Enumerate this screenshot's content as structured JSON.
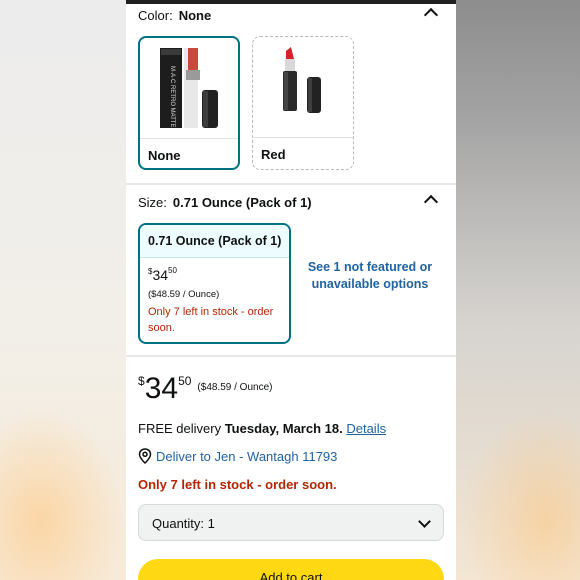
{
  "color_section": {
    "label": "Color:",
    "selected": "None",
    "options": [
      {
        "label": "None"
      },
      {
        "label": "Red"
      }
    ]
  },
  "size_section": {
    "label": "Size:",
    "selected": "0.71 Ounce (Pack of 1)",
    "card": {
      "title": "0.71 Ounce (Pack of 1)",
      "currency": "$",
      "price_whole": "34",
      "price_fraction": "50",
      "unit_price": "($48.59 / Ounce)",
      "stock": "Only 7 left in stock - order soon."
    },
    "see_more": "See 1 not featured or unavailable options"
  },
  "buybox": {
    "currency": "$",
    "price_whole": "34",
    "price_fraction": "50",
    "unit_price": "($48.59 / Ounce)",
    "delivery_prefix": "FREE delivery",
    "delivery_date": "Tuesday, March 18.",
    "details_link": "Details",
    "deliver_to": "Deliver to Jen - Wantagh 11793",
    "stock": "Only 7 left in stock - order soon.",
    "quantity_label": "Quantity:",
    "quantity_value": "1",
    "add_to_cart": "Add to cart"
  },
  "colors": {
    "teal_border": "#007185",
    "link_blue": "#2162a1",
    "stock_red": "#b12704",
    "cart_yellow": "#ffd814"
  }
}
